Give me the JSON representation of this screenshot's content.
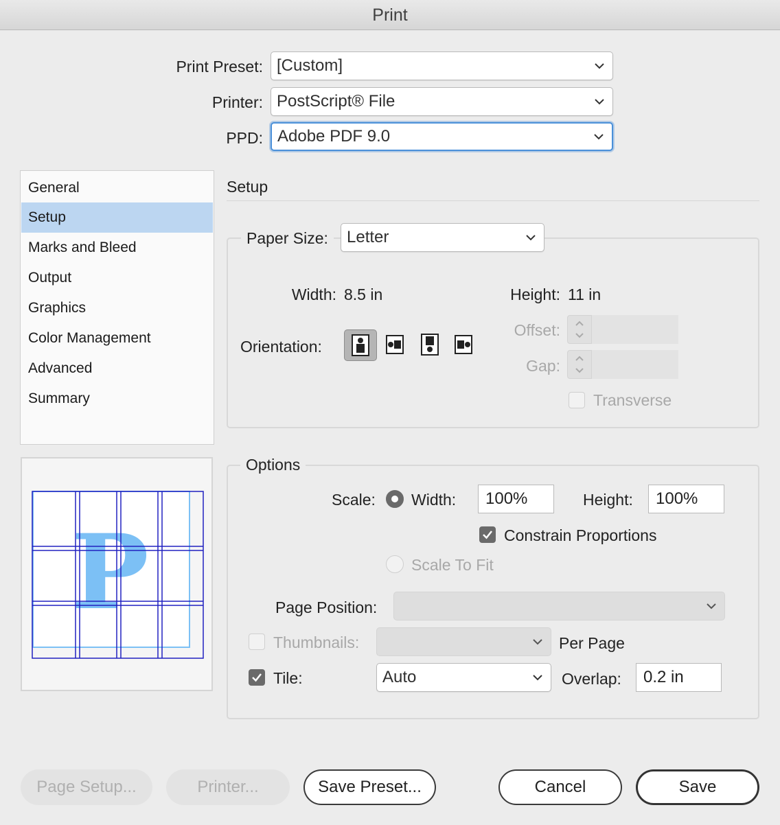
{
  "window": {
    "title": "Print"
  },
  "header": {
    "print_preset": {
      "label": "Print Preset:",
      "value": "[Custom]"
    },
    "printer": {
      "label": "Printer:",
      "value": "PostScript® File"
    },
    "ppd": {
      "label": "PPD:",
      "value": "Adobe PDF 9.0"
    }
  },
  "sidebar": {
    "items": [
      {
        "label": "General"
      },
      {
        "label": "Setup",
        "selected": true
      },
      {
        "label": "Marks and Bleed"
      },
      {
        "label": "Output"
      },
      {
        "label": "Graphics"
      },
      {
        "label": "Color Management"
      },
      {
        "label": "Advanced"
      },
      {
        "label": "Summary"
      }
    ]
  },
  "preview": {
    "glyph": "P",
    "colors": {
      "page": "#7cc0f5",
      "tiles": "#2020c0"
    }
  },
  "setup": {
    "section_title": "Setup",
    "paper_size": {
      "label": "Paper Size:",
      "value": "Letter"
    },
    "width": {
      "label": "Width:",
      "value": "8.5 in"
    },
    "height": {
      "label": "Height:",
      "value": "11 in"
    },
    "orientation": {
      "label": "Orientation:",
      "options": [
        "portrait-icon",
        "landscape-icon",
        "reverse-portrait-icon",
        "reverse-landscape-icon"
      ],
      "selected": 0
    },
    "offset": {
      "label": "Offset:",
      "value": ""
    },
    "gap": {
      "label": "Gap:",
      "value": ""
    },
    "transverse": {
      "label": "Transverse",
      "checked": false,
      "enabled": false
    }
  },
  "options": {
    "title": "Options",
    "scale_label": "Scale:",
    "scale_width": {
      "label": "Width:",
      "value": "100%",
      "selected": true
    },
    "scale_height": {
      "label": "Height:",
      "value": "100%"
    },
    "constrain": {
      "label": "Constrain Proportions",
      "checked": true
    },
    "scale_to_fit": {
      "label": "Scale To Fit",
      "selected": false,
      "enabled": false
    },
    "page_position": {
      "label": "Page Position:",
      "value": ""
    },
    "thumbnails": {
      "label": "Thumbnails:",
      "value": "",
      "checked": false,
      "suffix": "Per Page"
    },
    "tile": {
      "label": "Tile:",
      "value": "Auto",
      "checked": true
    },
    "overlap": {
      "label": "Overlap:",
      "value": "0.2 in"
    }
  },
  "footer": {
    "page_setup": "Page Setup...",
    "printer": "Printer...",
    "save_preset": "Save Preset...",
    "cancel": "Cancel",
    "save": "Save"
  },
  "colors": {
    "selection": "#bcd6f1",
    "focus": "#4a90d9"
  }
}
